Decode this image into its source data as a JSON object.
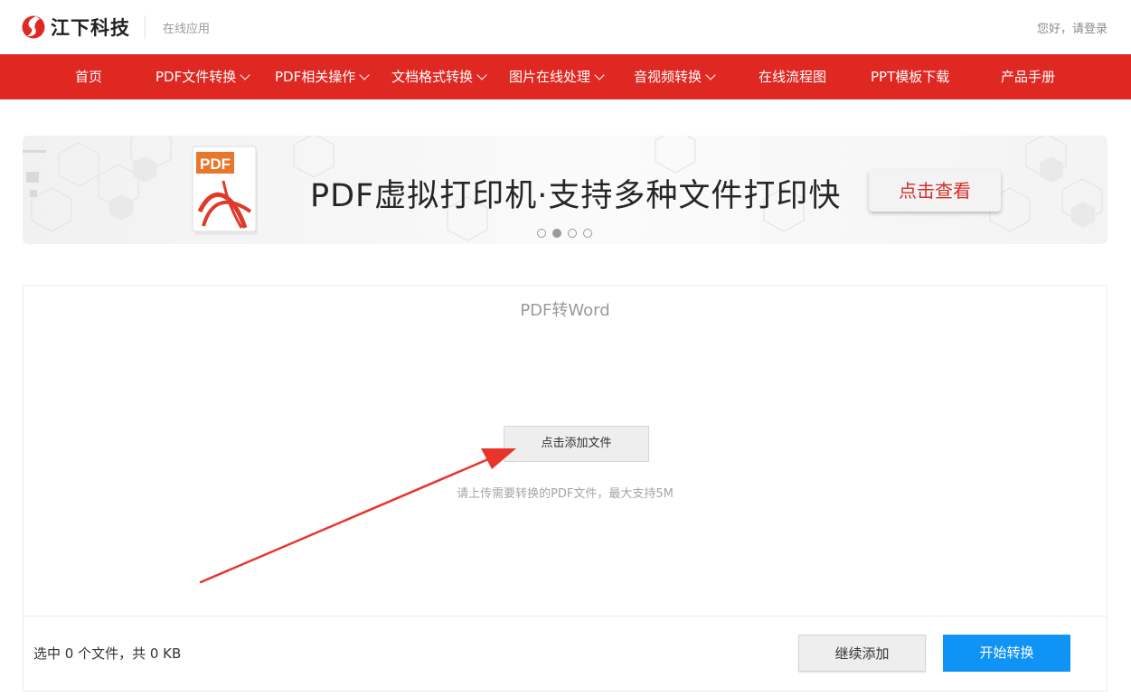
{
  "header": {
    "brand_name": "江下科技",
    "brand_sub": "在线应用",
    "login_text": "您好，请登录",
    "brand_color": "#e02823"
  },
  "nav": {
    "items": [
      {
        "label": "首页",
        "dropdown": false
      },
      {
        "label": "PDF文件转换",
        "dropdown": true
      },
      {
        "label": "PDF相关操作",
        "dropdown": true
      },
      {
        "label": "文档格式转换",
        "dropdown": true
      },
      {
        "label": "图片在线处理",
        "dropdown": true
      },
      {
        "label": "音视频转换",
        "dropdown": true
      },
      {
        "label": "在线流程图",
        "dropdown": false
      },
      {
        "label": "PPT模板下载",
        "dropdown": false
      },
      {
        "label": "产品手册",
        "dropdown": false
      }
    ],
    "background": "#e02823"
  },
  "banner": {
    "doc_label": "PDF",
    "title": "PDF虚拟打印机·支持多种文件打印快",
    "button_label": "点击查看",
    "slide_count": 4,
    "active_slide": 2
  },
  "panel": {
    "title": "PDF转Word",
    "add_file_label": "点击添加文件",
    "hint": "请上传需要转换的PDF文件，最大支持5M",
    "status": "选中 0 个文件，共 0 KB",
    "continue_label": "继续添加",
    "start_label": "开始转换",
    "start_color": "#0f93f5",
    "annotation_arrow_color": "#e8342b"
  }
}
